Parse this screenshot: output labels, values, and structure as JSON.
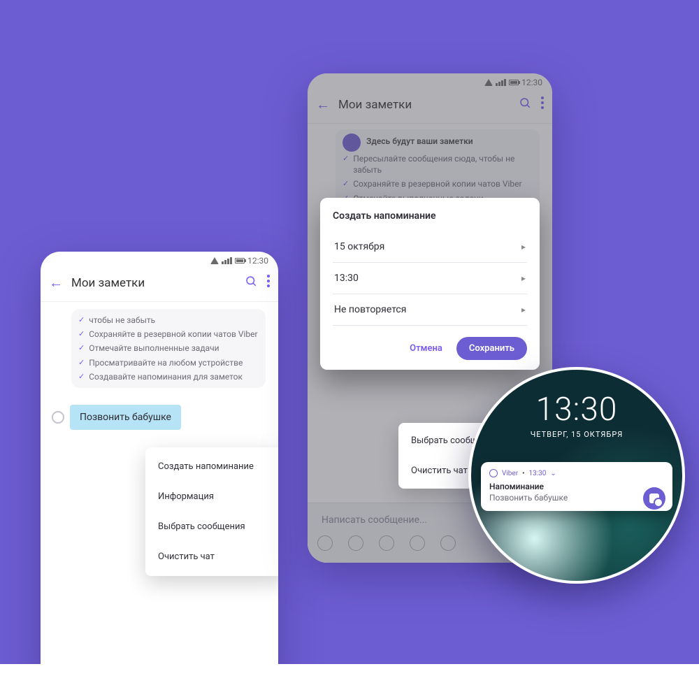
{
  "colors": {
    "accent": "#6d5dd3"
  },
  "phone1": {
    "status_time": "12:30",
    "title": "Мои заметки",
    "tips": [
      "чтобы не забыть",
      "Сохраняйте в резервной копии чатов Viber",
      "Отмечайте выполненные задачи",
      "Просматривайте на любом устройстве",
      "Создавайте напоминания для заметок"
    ],
    "message": "Позвонить бабушке",
    "menu": [
      "Создать напоминание",
      "Информация",
      "Выбрать сообщения",
      "Очистить чат"
    ]
  },
  "phone2": {
    "status_time": "12:30",
    "title": "Мои заметки",
    "intro_heading": "Здесь будут ваши заметки",
    "tips": [
      "Пересылайте сообщения сюда, чтобы не забыть",
      "Сохраняйте в резервной копии чатов Viber",
      "Отмечайте выполненные задачи"
    ],
    "dialog": {
      "title": "Создать напоминание",
      "date": "15 октября",
      "time": "13:30",
      "repeat": "Не повторяется",
      "cancel": "Отмена",
      "save": "Сохранить"
    },
    "below_menu": [
      "Выбрать сообщения",
      "Очистить чат"
    ],
    "composer_placeholder": "Написать сообщение..."
  },
  "lockscreen": {
    "time": "13:30",
    "date": "ЧЕТВЕРГ, 15 ОКТЯБРЯ",
    "app": "Viber",
    "meta_time": "13:30",
    "notif_title": "Напоминание",
    "notif_body": "Позвонить бабушке"
  }
}
